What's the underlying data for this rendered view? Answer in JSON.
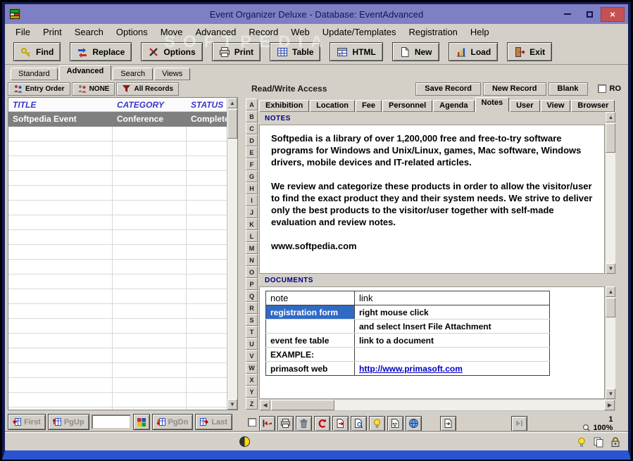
{
  "window": {
    "title": "Event Organizer Deluxe - Database: EventAdvanced",
    "watermark": "SOFTPEDIA",
    "controls": {
      "close": "×"
    }
  },
  "icons": {
    "arrow_up": "▲",
    "arrow_down": "▼",
    "arrow_left": "◀",
    "arrow_right": "▶"
  },
  "menu": {
    "items": [
      "File",
      "Print",
      "Search",
      "Options",
      "Move",
      "Advanced",
      "Record",
      "Web",
      "Update/Templates",
      "Registration",
      "Help"
    ]
  },
  "toolbar": {
    "buttons": [
      {
        "label": "Find"
      },
      {
        "label": "Replace"
      },
      {
        "label": "Options"
      },
      {
        "label": "Print"
      },
      {
        "label": "Table"
      },
      {
        "label": "HTML"
      },
      {
        "label": "New"
      },
      {
        "label": "Load"
      },
      {
        "label": "Exit"
      }
    ]
  },
  "view_tabs": {
    "items": [
      "Standard",
      "Advanced",
      "Search",
      "Views"
    ],
    "active": "Advanced"
  },
  "left_panel": {
    "order_label": "Entry Order",
    "sort_label": "NONE",
    "filter_label": "All Records",
    "columns": [
      "TITLE",
      "CATEGORY",
      "STATUS"
    ],
    "record": {
      "title": "Softpedia Event",
      "category": "Conference",
      "status": "Completed"
    },
    "nav": {
      "first": "First",
      "pgup": "PgUp",
      "pgdn": "PgDn",
      "last": "Last"
    }
  },
  "record_panel": {
    "access_label": "Read/Write Access",
    "save_label": "Save Record",
    "new_label": "New Record",
    "blank_label": "Blank",
    "ro_label": "RO",
    "tabs": {
      "items": [
        "Exhibition",
        "Location",
        "Fee",
        "Personnel",
        "Agenda",
        "Notes",
        "User",
        "View",
        "Browser"
      ],
      "active": "Notes"
    },
    "alphabet": [
      "A",
      "B",
      "C",
      "D",
      "E",
      "F",
      "G",
      "H",
      "I",
      "J",
      "K",
      "L",
      "M",
      "N",
      "O",
      "P",
      "Q",
      "R",
      "S",
      "T",
      "U",
      "V",
      "W",
      "X",
      "Y",
      "Z"
    ],
    "notes": {
      "label": "NOTES",
      "paragraph1": "Softpedia is a library of over 1,200,000 free and free-to-try software programs for Windows and Unix/Linux, games, Mac software, Windows drivers, mobile devices and IT-related articles.",
      "paragraph2": "We review and categorize these products in order to allow the visitor/user to find the exact product they and their system needs. We strive to deliver only the best products to the visitor/user together with self-made evaluation and review notes.",
      "url": "www.softpedia.com"
    },
    "documents": {
      "label": "DOCUMENTS",
      "columns": {
        "note": "note",
        "link": "link"
      },
      "rows": [
        {
          "note": "registration form",
          "link": "right mouse click"
        },
        {
          "note": "",
          "link": "and select Insert File Attachment"
        },
        {
          "note": "event fee table",
          "link": "link to a document"
        },
        {
          "note": "EXAMPLE:",
          "link": ""
        },
        {
          "note": "primasoft web",
          "link": "http://www.primasoft.com"
        }
      ]
    },
    "footer": {
      "record_number": "1",
      "zoom": "100%"
    }
  },
  "colors": {
    "titlebar": "#7e7fc4",
    "highlight": "#316ac5",
    "link": "#0000c8",
    "selected_row": "#7f7f7f",
    "label_blue": "#00007f",
    "header_blue": "#3838cc"
  }
}
